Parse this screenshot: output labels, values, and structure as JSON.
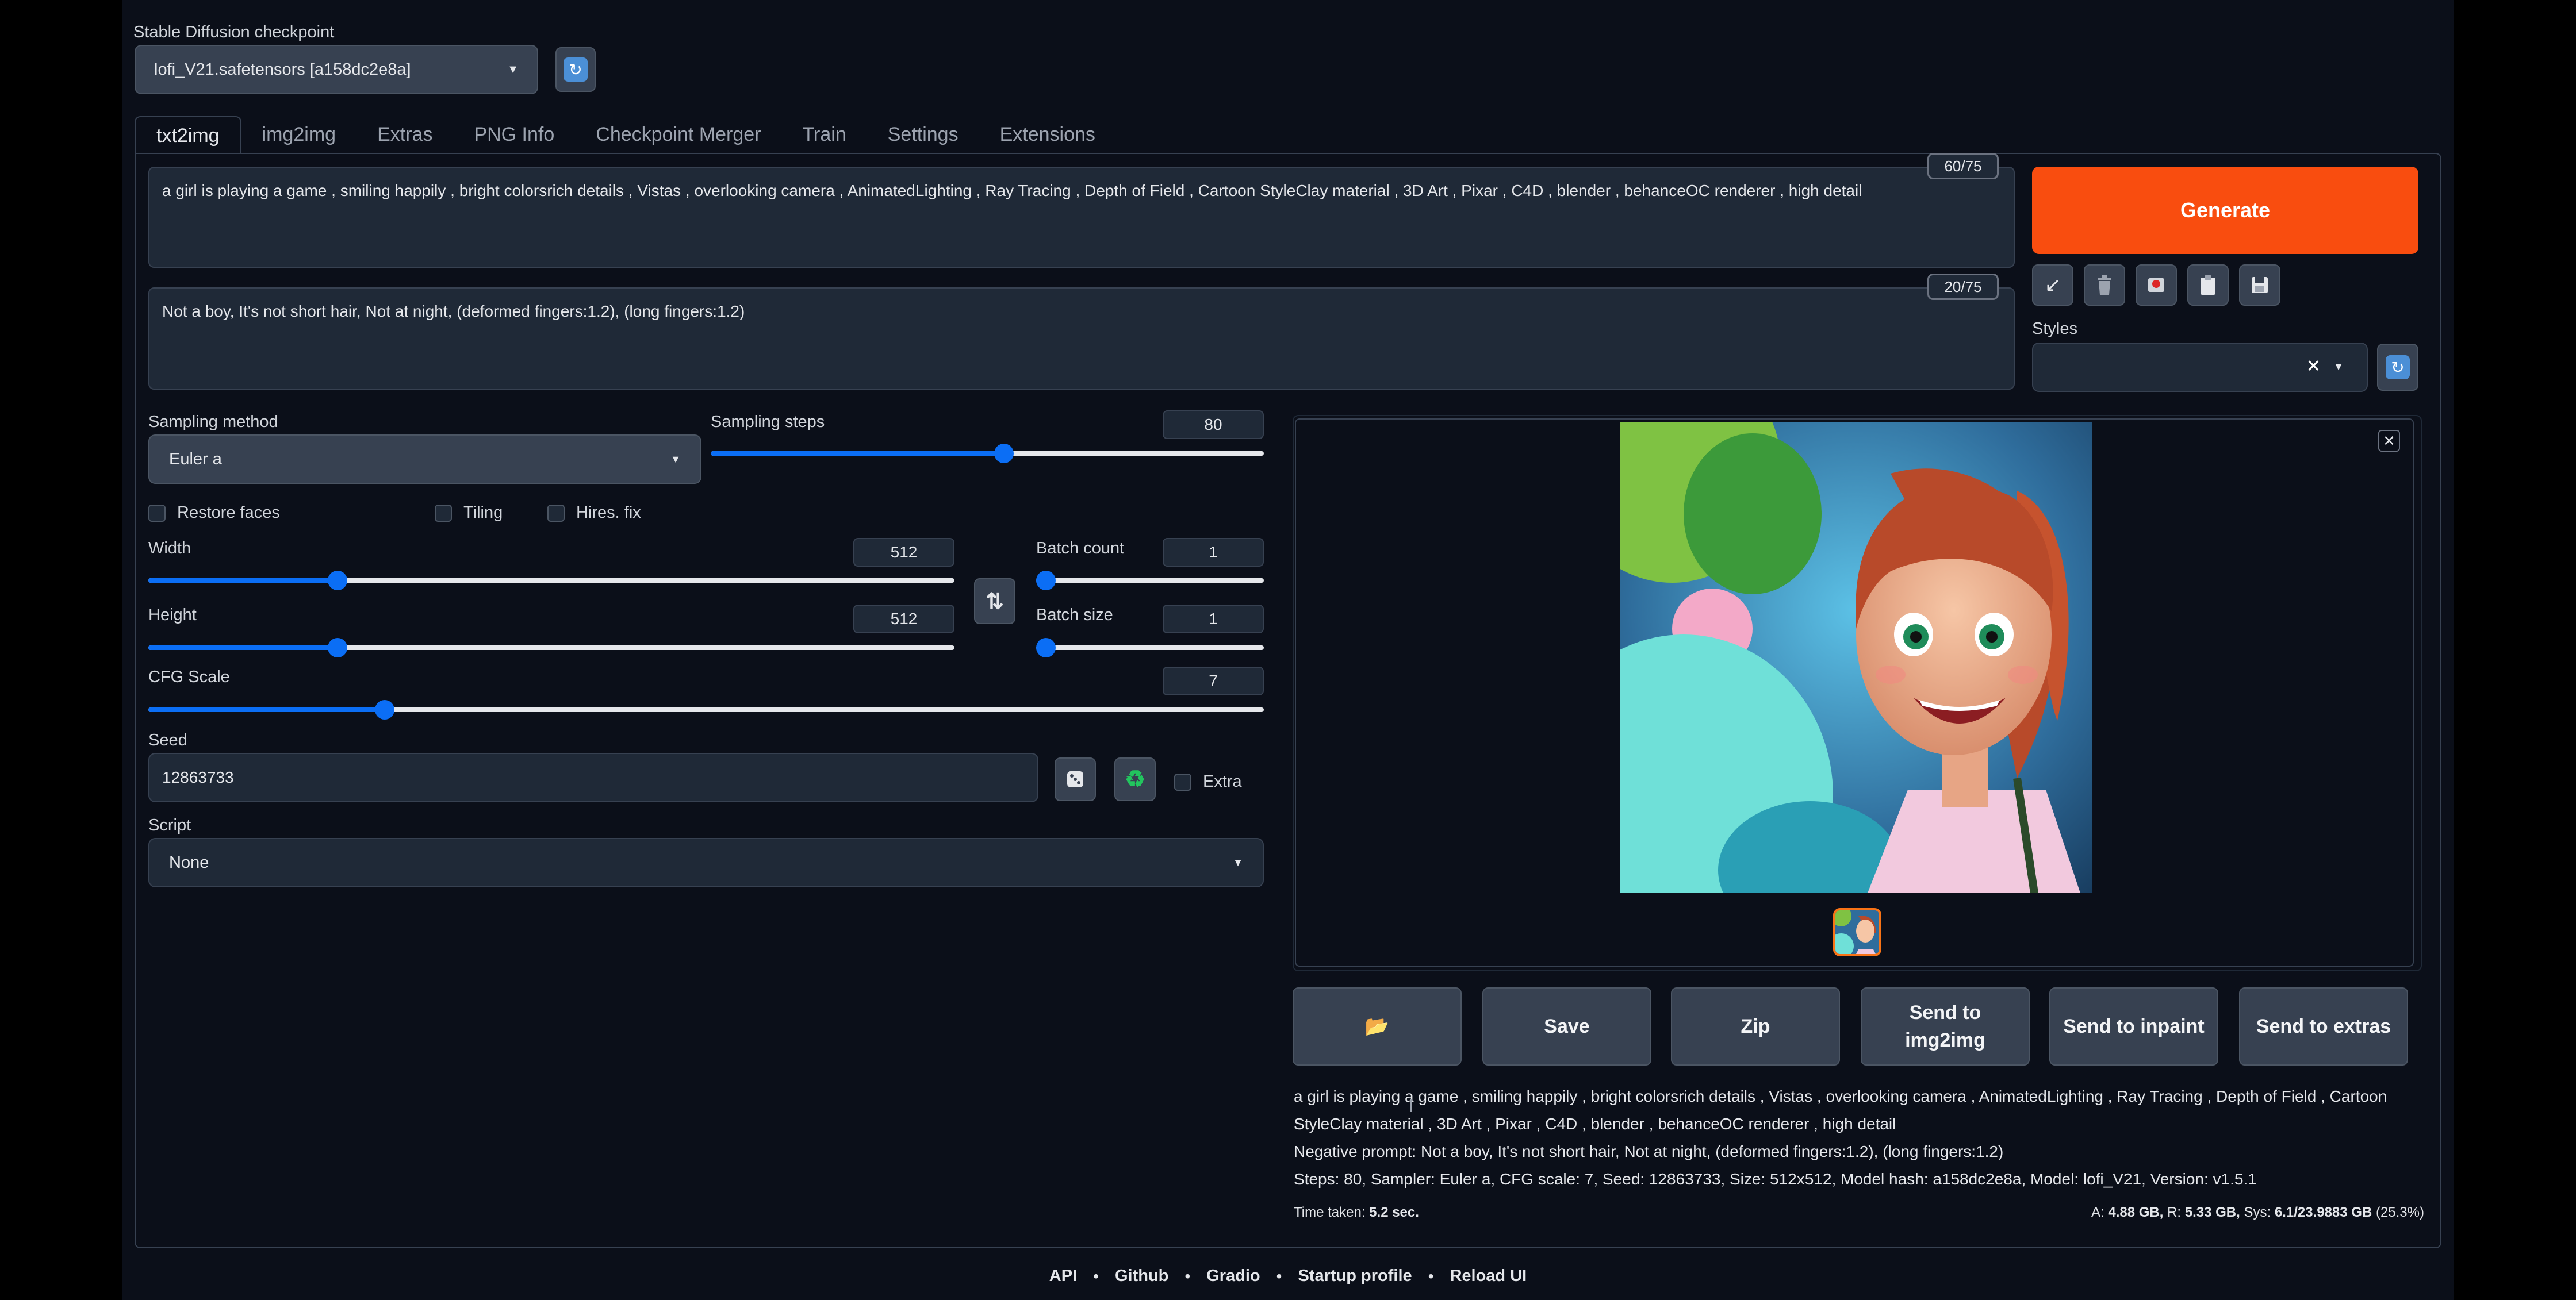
{
  "checkpoint": {
    "label": "Stable Diffusion checkpoint",
    "value": "lofi_V21.safetensors [a158dc2e8a]"
  },
  "tabs": [
    {
      "label": "txt2img",
      "active": true
    },
    {
      "label": "img2img"
    },
    {
      "label": "Extras"
    },
    {
      "label": "PNG Info"
    },
    {
      "label": "Checkpoint Merger"
    },
    {
      "label": "Train"
    },
    {
      "label": "Settings"
    },
    {
      "label": "Extensions"
    }
  ],
  "prompt": {
    "value": "a girl is playing a game , smiling happily , bright colorsrich details , Vistas , overlooking camera , AnimatedLighting , Ray Tracing , Depth of Field , Cartoon StyleClay material , 3D Art , Pixar , C4D , blender , behanceOC renderer , high detail",
    "token_count": "60/75"
  },
  "negative_prompt": {
    "value": "Not a boy,   It's not short hair,   Not at night,   (deformed fingers:1.2), (long fingers:1.2)",
    "token_count": "20/75"
  },
  "generate": {
    "label": "Generate",
    "color": "#f94d0f"
  },
  "styles": {
    "label": "Styles"
  },
  "sampling": {
    "method_label": "Sampling method",
    "method_value": "Euler a",
    "steps_label": "Sampling steps",
    "steps_value": "80",
    "steps_fraction": 0.53
  },
  "options": {
    "restore_faces": "Restore faces",
    "tiling": "Tiling",
    "hires_fix": "Hires. fix"
  },
  "width": {
    "label": "Width",
    "value": "512",
    "fraction": 0.235
  },
  "height": {
    "label": "Height",
    "value": "512",
    "fraction": 0.235
  },
  "batch_count": {
    "label": "Batch count",
    "value": "1",
    "fraction": 0.0
  },
  "batch_size": {
    "label": "Batch size",
    "value": "1",
    "fraction": 0.0
  },
  "cfg": {
    "label": "CFG Scale",
    "value": "7",
    "fraction": 0.212
  },
  "seed": {
    "label": "Seed",
    "value": "12863733",
    "extra_label": "Extra"
  },
  "script": {
    "label": "Script",
    "value": "None"
  },
  "output_buttons": {
    "folder": "📂",
    "save": "Save",
    "zip": "Zip",
    "send_img2img": "Send to img2img",
    "send_inpaint": "Send to inpaint",
    "send_extras": "Send to extras"
  },
  "info": {
    "line1": "a girl is playing a game , smiling happily , bright colorsrich details , Vistas , overlooking camera , AnimatedLighting , Ray Tracing , Depth of Field , Cartoon StyleClay material , 3D Art , Pixar , C4D , blender , behanceOC renderer , high detail",
    "negative": "Negative prompt: Not a boy,   It's not short hair,   Not at night,   (deformed fingers:1.2), (long fingers:1.2)",
    "params": "Steps: 80, Sampler: Euler a, CFG scale: 7, Seed: 12863733, Size: 512x512, Model hash: a158dc2e8a, Model: lofi_V21, Version: v1.5.1"
  },
  "stats": {
    "time_label": "Time taken:",
    "time_value": "5.2 sec.",
    "a_label": "A:",
    "a_value": "4.88 GB,",
    "r_label": "R:",
    "r_value": "5.33 GB,",
    "sys_label": "Sys:",
    "sys_value": "6.1/23.9883 GB",
    "sys_pct": "(25.3%)"
  },
  "footer": [
    "API",
    "Github",
    "Gradio",
    "Startup profile",
    "Reload UI"
  ]
}
